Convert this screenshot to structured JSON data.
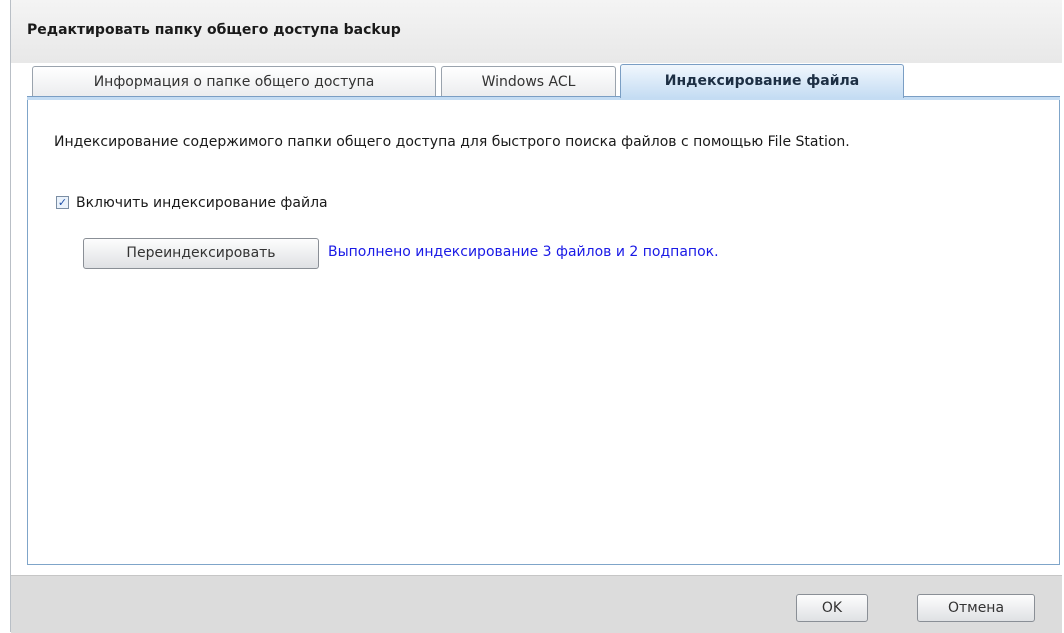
{
  "dialog": {
    "title": "Редактировать папку общего доступа backup"
  },
  "tabs": [
    {
      "label": "Информация о папке общего доступа",
      "active": false
    },
    {
      "label": "Windows ACL",
      "active": false
    },
    {
      "label": "Индексирование файла",
      "active": true
    }
  ],
  "indexing": {
    "description": "Индексирование содержимого папки общего доступа для быстрого поиска файлов с помощью File Station.",
    "enable_label": "Включить индексирование файла",
    "enable_checked": true,
    "checkmark": "✓",
    "reindex_button": "Переиндексировать",
    "status_text": "Выполнено индексирование 3 файлов и 2 подпапок."
  },
  "footer": {
    "ok_label": "OK",
    "cancel_label": "Отмена"
  },
  "colors": {
    "status_text": "#1a1ae6",
    "active_tab": "#c4dcf3",
    "panel_border": "#7fa5c9"
  }
}
